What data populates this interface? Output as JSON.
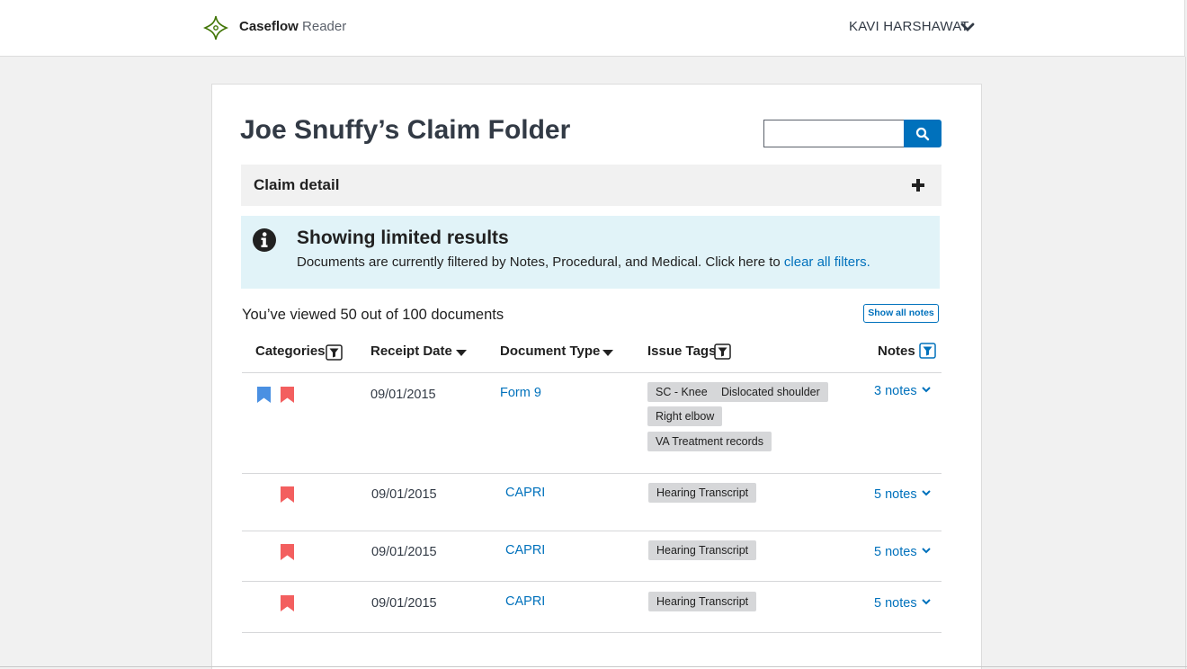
{
  "header": {
    "brand_bold": "Caseflow",
    "brand_light": "Reader",
    "user_name": "KAVI HARSHAWAT"
  },
  "page": {
    "title": "Joe Snuffy’s Claim Folder",
    "search": {
      "value": "",
      "placeholder": ""
    }
  },
  "claim_detail": {
    "label": "Claim detail"
  },
  "alert": {
    "title": "Showing limited results",
    "body": "Documents are currently filtered by Notes, Procedural, and Medical. Click here to ",
    "link": "clear all filters."
  },
  "documents": {
    "viewed_text": "You’ve viewed 50 out of 100 documents",
    "show_all_notes": "Show all notes",
    "columns": {
      "categories": "Categories",
      "receipt_date": "Receipt Date",
      "document_type": "Document Type",
      "issue_tags": "Issue Tags",
      "notes": "Notes"
    },
    "rows": [
      {
        "categories": [
          "blue",
          "red"
        ],
        "date": "09/01/2015",
        "type": "Form 9",
        "tags": [
          "SC - Knee",
          "Dislocated shoulder",
          "Right elbow",
          "VA Treatment records"
        ],
        "notes": "3 notes"
      },
      {
        "categories": [
          "red"
        ],
        "date": "09/01/2015",
        "type": "CAPRI",
        "tags": [
          "Hearing Transcript"
        ],
        "notes": "5 notes"
      },
      {
        "categories": [
          "red"
        ],
        "date": "09/01/2015",
        "type": "CAPRI",
        "tags": [
          "Hearing Transcript"
        ],
        "notes": "5 notes"
      },
      {
        "categories": [
          "red"
        ],
        "date": "09/01/2015",
        "type": "CAPRI",
        "tags": [
          "Hearing Transcript"
        ],
        "notes": "5 notes"
      }
    ]
  },
  "colors": {
    "primary": "#0071bc",
    "category_blue": "#4a90e2",
    "category_red": "#f35f5f",
    "alert_bg": "#e1f3f8",
    "logo_green": "#417505"
  },
  "icons": [
    "caseflow-logo-icon",
    "chevron-down-icon",
    "search-icon",
    "plus-icon",
    "info-icon",
    "filter-icon",
    "sort-caret-icon",
    "bookmark-icon"
  ]
}
